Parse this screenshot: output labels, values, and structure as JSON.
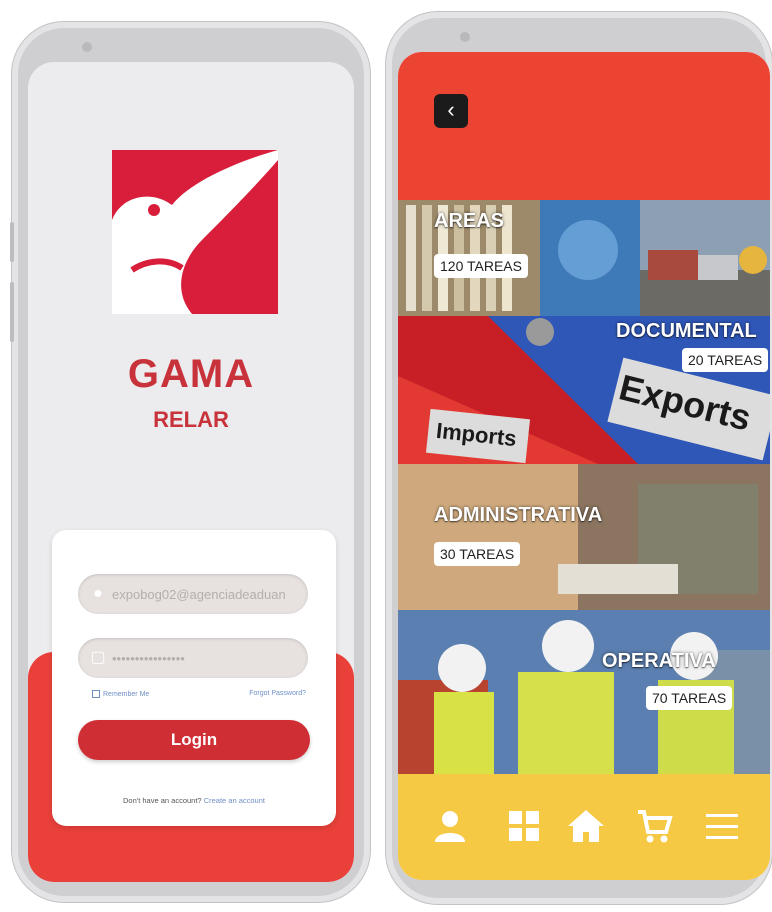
{
  "login_screen": {
    "brand_title": "GAMA",
    "brand_subtitle": "RELAR",
    "email_value": "expobog02@agenciadeaduan",
    "password_value": "••••••••••••••••",
    "remember_label": "Remember Me",
    "forgot_label": "Forgot Password?",
    "login_label": "Login",
    "signup_prompt": "Don't have an account?",
    "signup_link": "Create an account"
  },
  "menu_screen": {
    "back_label": "‹",
    "sections": [
      {
        "title": "AREAS",
        "badge": "120 TAREAS"
      },
      {
        "title": "DOCUMENTAL",
        "badge": "20 TAREAS",
        "folder_text_1": "Exports",
        "folder_text_2": "Imports"
      },
      {
        "title": "ADMINISTRATIVA",
        "badge": "30 TAREAS"
      },
      {
        "title": "OPERATIVA",
        "badge": "70 TAREAS"
      }
    ],
    "nav_icons": [
      "user-icon",
      "grid-icon",
      "home-icon",
      "cart-icon",
      "menu-icon"
    ]
  },
  "colors": {
    "brand_red": "#d81e3a",
    "login_red": "#e9403a",
    "topbar_red": "#ec4433",
    "nav_yellow": "#f6c944"
  }
}
